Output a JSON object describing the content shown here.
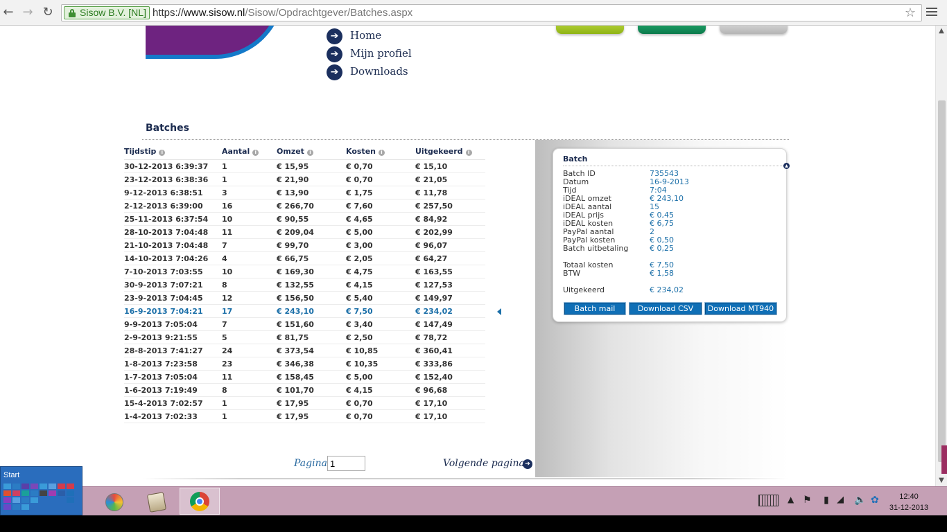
{
  "browser": {
    "secure_label": "Sisow B.V. [NL]",
    "url_scheme": "https://",
    "url_host": "www.sisow.nl",
    "url_path": "/Sisow/Opdrachtgever/Batches.aspx"
  },
  "nav": {
    "items": [
      {
        "label": "Home"
      },
      {
        "label": "Mijn profiel"
      },
      {
        "label": "Downloads"
      }
    ]
  },
  "section": {
    "title": "Batches"
  },
  "table": {
    "headers": [
      "Tijdstip",
      "Aantal",
      "Omzet",
      "Kosten",
      "Uitgekeerd"
    ],
    "rows": [
      [
        "30-12-2013 6:39:37",
        "1",
        "€ 15,95",
        "€ 0,70",
        "€ 15,10"
      ],
      [
        "23-12-2013 6:38:36",
        "1",
        "€ 21,90",
        "€ 0,70",
        "€ 21,05"
      ],
      [
        "9-12-2013 6:38:51",
        "3",
        "€ 13,90",
        "€ 1,75",
        "€ 11,78"
      ],
      [
        "2-12-2013 6:39:00",
        "16",
        "€ 266,70",
        "€ 7,60",
        "€ 257,50"
      ],
      [
        "25-11-2013 6:37:54",
        "10",
        "€ 90,55",
        "€ 4,65",
        "€ 84,92"
      ],
      [
        "28-10-2013 7:04:48",
        "11",
        "€ 209,04",
        "€ 5,00",
        "€ 202,99"
      ],
      [
        "21-10-2013 7:04:48",
        "7",
        "€ 99,70",
        "€ 3,00",
        "€ 96,07"
      ],
      [
        "14-10-2013 7:04:26",
        "4",
        "€ 66,75",
        "€ 2,05",
        "€ 64,27"
      ],
      [
        "7-10-2013 7:03:55",
        "10",
        "€ 169,30",
        "€ 4,75",
        "€ 163,55"
      ],
      [
        "30-9-2013 7:07:21",
        "8",
        "€ 132,55",
        "€ 4,15",
        "€ 127,53"
      ],
      [
        "23-9-2013 7:04:45",
        "12",
        "€ 156,50",
        "€ 5,40",
        "€ 149,97"
      ],
      [
        "16-9-2013 7:04:21",
        "17",
        "€ 243,10",
        "€ 7,50",
        "€ 234,02"
      ],
      [
        "9-9-2013 7:05:04",
        "7",
        "€ 151,60",
        "€ 3,40",
        "€ 147,49"
      ],
      [
        "2-9-2013 9:21:55",
        "5",
        "€ 81,75",
        "€ 2,50",
        "€ 78,72"
      ],
      [
        "28-8-2013 7:41:27",
        "24",
        "€ 373,54",
        "€ 10,85",
        "€ 360,41"
      ],
      [
        "1-8-2013 7:23:58",
        "23",
        "€ 346,38",
        "€ 10,35",
        "€ 333,86"
      ],
      [
        "1-7-2013 7:05:04",
        "11",
        "€ 158,45",
        "€ 5,00",
        "€ 152,40"
      ],
      [
        "1-6-2013 7:19:49",
        "8",
        "€ 101,70",
        "€ 4,15",
        "€ 96,68"
      ],
      [
        "15-4-2013 7:02:57",
        "1",
        "€ 17,95",
        "€ 0,70",
        "€ 17,10"
      ],
      [
        "1-4-2013 7:02:33",
        "1",
        "€ 17,95",
        "€ 0,70",
        "€ 17,10"
      ]
    ],
    "selected_index": 11
  },
  "pager": {
    "label": "Pagina",
    "value": "1",
    "next_label": "Volgende pagina"
  },
  "batch": {
    "title": "Batch",
    "fields": [
      {
        "key": "Batch ID",
        "value": "735543"
      },
      {
        "key": "Datum",
        "value": "16-9-2013"
      },
      {
        "key": "Tijd",
        "value": "7:04"
      },
      {
        "key": "iDEAL omzet",
        "value": "€ 243,10"
      },
      {
        "key": "iDEAL aantal",
        "value": "15"
      },
      {
        "key": "iDEAL prijs",
        "value": "€ 0,45"
      },
      {
        "key": "iDEAL kosten",
        "value": "€ 6,75"
      },
      {
        "key": "PayPal aantal",
        "value": "2"
      },
      {
        "key": "PayPal kosten",
        "value": "€ 0,50"
      },
      {
        "key": "Batch uitbetaling",
        "value": "€ 0,25"
      },
      {
        "key": "Totaal kosten",
        "value": "€ 7,50"
      },
      {
        "key": "BTW",
        "value": "€ 1,58"
      },
      {
        "key": "Uitgekeerd",
        "value": "€ 234,02"
      }
    ],
    "buttons": [
      "Batch mail",
      "Download CSV",
      "Download MT940"
    ]
  },
  "taskbar": {
    "start_label": "Start",
    "time": "12:40",
    "date": "31-12-2013"
  }
}
